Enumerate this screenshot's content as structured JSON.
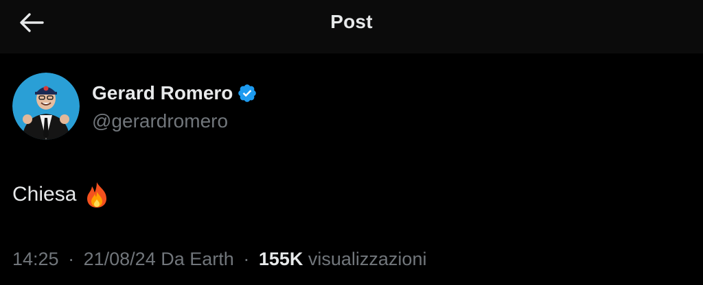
{
  "header": {
    "title": "Post",
    "back_icon": "arrow-left-icon"
  },
  "author": {
    "display_name": "Gerard Romero",
    "handle": "@gerardromero",
    "verified_icon": "verified-badge-icon",
    "verified_color": "#1d9bf0",
    "avatar_bg": "#2a9fd6"
  },
  "post": {
    "text": "Chiesa",
    "emoji_icon": "fire-icon"
  },
  "meta": {
    "time": "14:25",
    "date": "21/08/24",
    "source": "Da Earth",
    "separator": "·",
    "views_count": "155K",
    "views_label": "visualizzazioni"
  },
  "colors": {
    "background": "#000000",
    "header_bg": "#0b0b0b",
    "primary_text": "#e7e9ea",
    "secondary_text": "#71767b"
  }
}
